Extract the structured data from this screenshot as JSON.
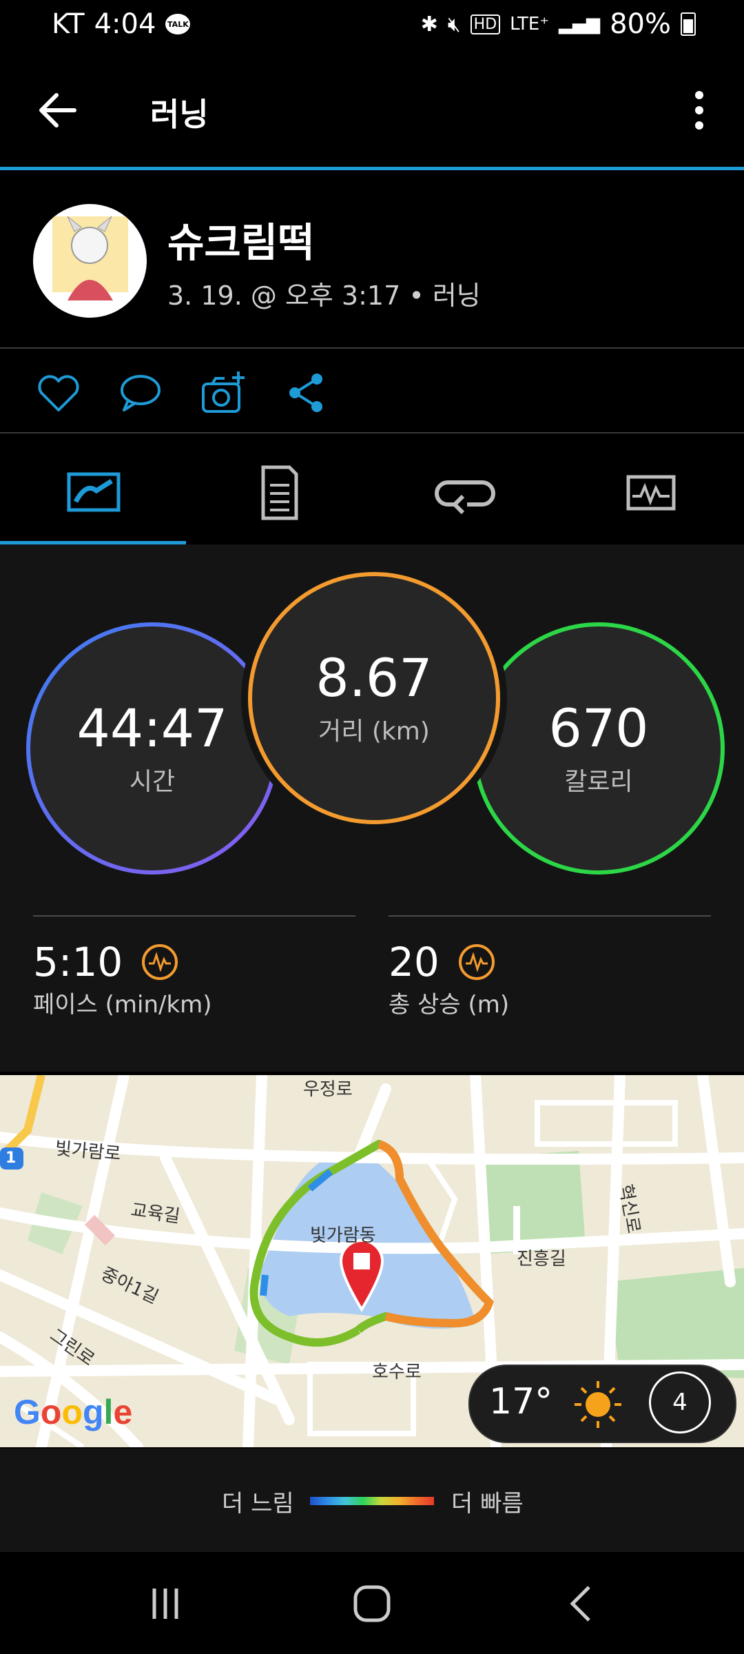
{
  "status_bar": {
    "carrier": "KT",
    "time": "4:04",
    "talk_badge": "TALK",
    "battery": "80%"
  },
  "app_bar": {
    "title": "러닝"
  },
  "profile": {
    "name": "슈크림떡",
    "meta": "3. 19. @ 오후 3:17 • 러닝"
  },
  "stats": {
    "time": {
      "value": "44:47",
      "label": "시간"
    },
    "distance": {
      "value": "8.67",
      "label": "거리 (km)"
    },
    "calories": {
      "value": "670",
      "label": "칼로리"
    },
    "pace": {
      "value": "5:10",
      "label": "페이스 (min/km)"
    },
    "ascent": {
      "value": "20",
      "label": "총 상승 (m)"
    }
  },
  "map": {
    "labels": [
      "우정로",
      "빛가람로",
      "교육길",
      "중아1길",
      "그린로",
      "빛가람동",
      "진흥길",
      "혁신로",
      "호수로"
    ],
    "route_marker": "1",
    "google": "Google"
  },
  "weather": {
    "temp": "17°",
    "wind": "4"
  },
  "legend": {
    "slow": "더 느림",
    "fast": "더 빠름"
  },
  "colors": {
    "accent": "#1e9bd7",
    "distance_ring": "#f39b2f",
    "calorie_ring": "#2cd646",
    "time_ring": "#5a6ef0"
  }
}
